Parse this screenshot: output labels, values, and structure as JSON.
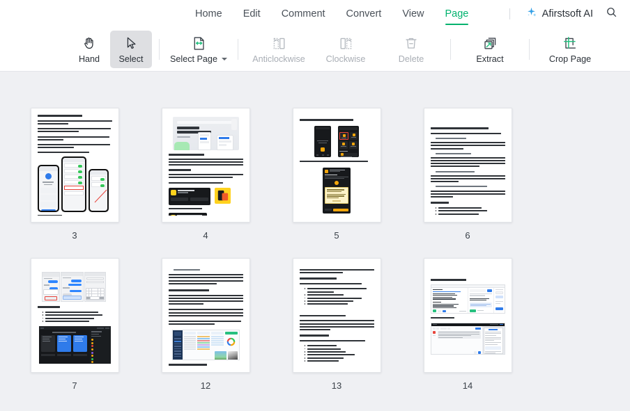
{
  "menu": {
    "tabs": [
      {
        "label": "Home",
        "active": false
      },
      {
        "label": "Edit",
        "active": false
      },
      {
        "label": "Comment",
        "active": false
      },
      {
        "label": "Convert",
        "active": false
      },
      {
        "label": "View",
        "active": false
      },
      {
        "label": "Page",
        "active": true
      }
    ],
    "ai_label": "Afirstsoft AI",
    "ai_icon": "sparkle-icon",
    "search_icon": "search-icon"
  },
  "toolbar": {
    "tools": [
      {
        "name": "hand",
        "label": "Hand",
        "icon": "hand-icon",
        "state": "enabled"
      },
      {
        "name": "select",
        "label": "Select",
        "icon": "cursor-icon",
        "state": "active"
      },
      {
        "name": "select-page",
        "label": "Select Page",
        "icon": "page-resize-icon",
        "state": "enabled",
        "dropdown": true
      },
      {
        "name": "anticlockwise",
        "label": "Anticlockwise",
        "icon": "rotate-left-icon",
        "state": "disabled"
      },
      {
        "name": "clockwise",
        "label": "Clockwise",
        "icon": "rotate-right-icon",
        "state": "disabled"
      },
      {
        "name": "delete",
        "label": "Delete",
        "icon": "trash-icon",
        "state": "disabled"
      },
      {
        "name": "extract",
        "label": "Extract",
        "icon": "extract-pages-icon",
        "state": "enabled"
      },
      {
        "name": "crop-page",
        "label": "Crop Page",
        "icon": "crop-icon",
        "state": "enabled"
      }
    ]
  },
  "colors": {
    "accent_green": "#00b26e",
    "brand_blue": "#2f9ee6",
    "canvas_gray": "#eff0f3",
    "text_dark": "#2b3138",
    "text_disabled": "#a9aeb5"
  },
  "pages": [
    {
      "number": "3",
      "kind": "text-and-phones"
    },
    {
      "number": "4",
      "kind": "banner-and-darkcards"
    },
    {
      "number": "5",
      "kind": "dark-app-screens"
    },
    {
      "number": "6",
      "kind": "text-only"
    },
    {
      "number": "7",
      "kind": "imessage-and-dashboard"
    },
    {
      "number": "12",
      "kind": "text-and-dashboard"
    },
    {
      "number": "13",
      "kind": "text-bullets"
    },
    {
      "number": "14",
      "kind": "light-app-screens"
    }
  ]
}
